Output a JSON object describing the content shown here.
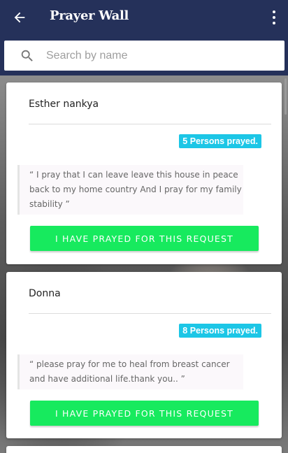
{
  "app": {
    "title": "Prayer Wall",
    "back_icon": "arrow-back-icon",
    "menu_icon": "more-vert-icon"
  },
  "search": {
    "placeholder": "Search by name",
    "value": "",
    "icon": "search-icon"
  },
  "colors": {
    "appbar": "#25315a",
    "badge": "#1cc6e6",
    "button": "#17ea5e"
  },
  "requests": [
    {
      "name": "Esther nankya",
      "prayed_count": "5 Persons prayed.",
      "text": "“ I pray that I can leave leave this house in peace back to my home country And I pray for my family stability ”",
      "button_label": "I HAVE PRAYED FOR THIS REQUEST"
    },
    {
      "name": "Donna",
      "prayed_count": "8 Persons prayed.",
      "text": "“ please pray for me to heal from breast cancer and have additional life.thank you.. ”",
      "button_label": "I HAVE PRAYED FOR THIS REQUEST"
    }
  ]
}
